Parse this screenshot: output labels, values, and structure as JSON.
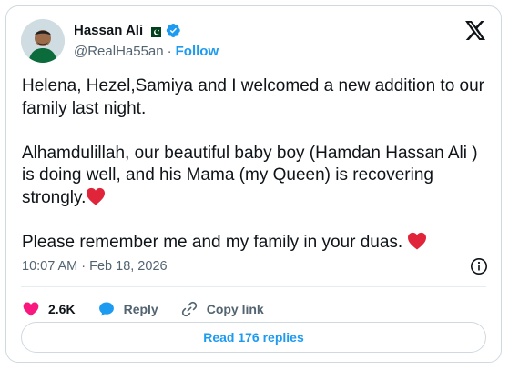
{
  "author": {
    "name": "Hassan Ali",
    "handle": "@RealHa55an",
    "separator": "·",
    "follow_label": "Follow"
  },
  "icons": {
    "flag": "pakistan-flag-icon",
    "verified": "verified-badge-icon",
    "logo": "x-logo-icon",
    "heart_inline": "red-heart-emoji",
    "info": "info-icon",
    "like": "heart-icon",
    "reply": "speech-bubble-icon",
    "copy": "link-icon"
  },
  "colors": {
    "accent": "#1d9bf0",
    "like": "#f91880",
    "heart_emoji": "#e0243a",
    "flag_green": "#01411c"
  },
  "tweet": {
    "line1": "Helena, Hezel,Samiya and I welcomed a new addition to our family last night.",
    "line2": "Alhamdulillah, our beautiful baby boy (Hamdan Hassan Ali ) is doing well, and his Mama (my Queen) is recovering strongly.",
    "line3": "Please remember me and my family in your duas. "
  },
  "meta": {
    "time": "10:07 AM",
    "separator": "·",
    "date": "Feb 18, 2026"
  },
  "actions": {
    "likes": "2.6K",
    "reply_label": "Reply",
    "copy_label": "Copy link"
  },
  "read_replies_label": "Read 176 replies"
}
